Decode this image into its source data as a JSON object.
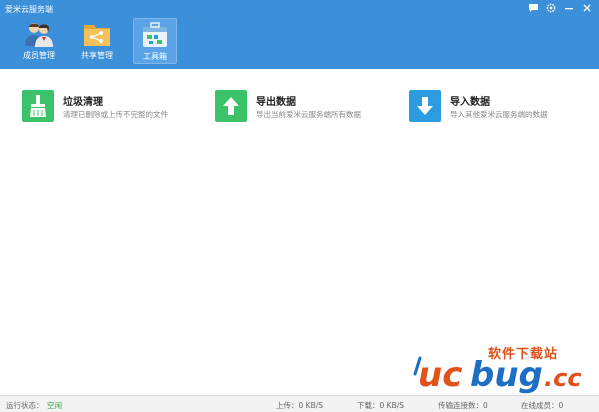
{
  "window": {
    "title": "爱米云服务端",
    "controls": [
      "chat-icon",
      "gear-icon",
      "minimize-icon",
      "close-icon"
    ]
  },
  "toolbar": {
    "items": [
      {
        "label": "成员管理",
        "icon": "users-icon",
        "active": false
      },
      {
        "label": "共享管理",
        "icon": "shared-folder-icon",
        "active": false
      },
      {
        "label": "工具箱",
        "icon": "toolbox-icon",
        "active": true
      }
    ]
  },
  "features": [
    {
      "title": "垃圾清理",
      "desc": "清理已删除或上传不完整的文件",
      "icon": "broom-icon",
      "color": "#3cc36a"
    },
    {
      "title": "导出数据",
      "desc": "导出当前爱米云服务端所有数据",
      "icon": "export-icon",
      "color": "#3cc36a"
    },
    {
      "title": "导入数据",
      "desc": "导入其他爱米云服务端的数据",
      "icon": "import-icon",
      "color": "#2d9be0"
    }
  ],
  "status": {
    "run_label": "运行状态：",
    "run_value": "空闲",
    "upload": "上传：0 KB/S",
    "download": "下载：0 KB/S",
    "connections": "传输连接数：0",
    "online": "在线成员：0"
  },
  "watermark": {
    "cn_text": "软件下载站",
    "logo_text": "ucbug.cc"
  },
  "colors": {
    "titlebar": "#3c8fd9",
    "green": "#3cc36a",
    "blue": "#2d9be0",
    "watermark_orange": "#e0521c",
    "watermark_blue": "#1e6fc4"
  }
}
